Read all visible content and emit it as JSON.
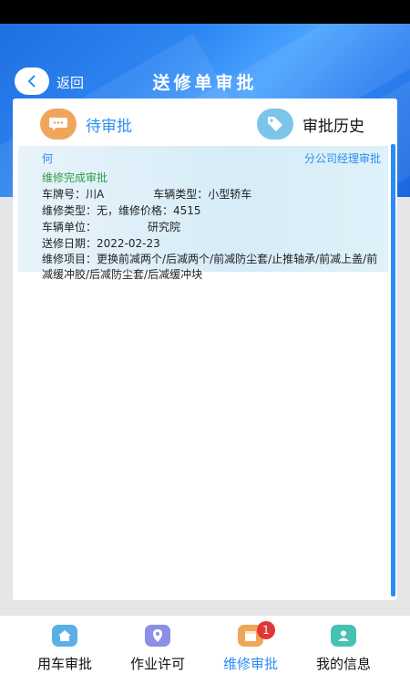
{
  "header": {
    "back_label": "返回",
    "title": "送修单审批"
  },
  "tabs": [
    {
      "label": "待审批",
      "icon": "chat-bubble-icon",
      "color": "#f0a65a",
      "active": true
    },
    {
      "label": "审批历史",
      "icon": "tag-icon",
      "color": "#7cc4ea",
      "active": false
    }
  ],
  "record": {
    "person": "何",
    "stage": "分公司经理审批",
    "status": "维修完成审批",
    "plate": "车牌号：川A",
    "vehicle_type": "车辆类型：小型轿车",
    "repair_type": "维修类型：无，维修价格：4515",
    "vehicle_unit": "车辆单位：",
    "vehicle_unit_suffix": "研究院",
    "send_date": "送修日期：2022-02-23",
    "repair_items": "维修项目：更换前减两个/后减两个/前减防尘套/止推轴承/前减上盖/前减缓冲胶/后减防尘套/后减缓冲块"
  },
  "nav": [
    {
      "label": "用车审批",
      "icon": "home-icon",
      "color": "#5ab0e6"
    },
    {
      "label": "作业许可",
      "icon": "location-icon",
      "color": "#8b8fe6"
    },
    {
      "label": "维修审批",
      "icon": "calendar-icon",
      "color": "#f0a65a",
      "badge": "1",
      "active": true
    },
    {
      "label": "我的信息",
      "icon": "user-icon",
      "color": "#46c2b2"
    }
  ],
  "colors": {
    "accent": "#2b8df2",
    "status_green": "#2aa044",
    "badge_red": "#e23636"
  }
}
